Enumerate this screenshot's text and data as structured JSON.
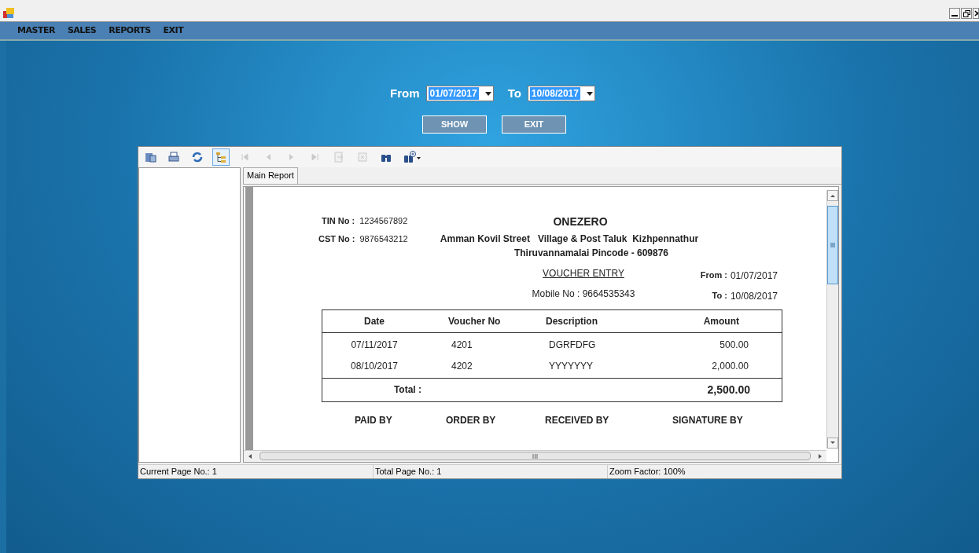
{
  "menu": [
    "MASTER",
    "SALES",
    "REPORTS",
    "EXIT"
  ],
  "filter": {
    "from_label": "From",
    "from_value": "01/07/2017",
    "to_label": "To",
    "to_value": "10/08/2017",
    "buttons": [
      "SHOW",
      "EXIT"
    ]
  },
  "viewer": {
    "toolbar": [
      {
        "kind": "export",
        "disabled": false,
        "selected": false
      },
      {
        "kind": "print",
        "disabled": false,
        "selected": false
      },
      {
        "kind": "refresh",
        "disabled": false,
        "selected": false
      },
      {
        "kind": "tree",
        "disabled": false,
        "selected": true
      },
      {
        "kind": "first",
        "disabled": true,
        "selected": false
      },
      {
        "kind": "prev",
        "disabled": true,
        "selected": false
      },
      {
        "kind": "next",
        "disabled": true,
        "selected": false
      },
      {
        "kind": "last",
        "disabled": true,
        "selected": false
      },
      {
        "kind": "goto",
        "disabled": true,
        "selected": false
      },
      {
        "kind": "stop",
        "disabled": true,
        "selected": false
      },
      {
        "kind": "search",
        "disabled": false,
        "selected": false
      },
      {
        "kind": "zoom",
        "disabled": false,
        "selected": false
      }
    ],
    "tab": "Main Report",
    "report": {
      "tin_label": "TIN No :",
      "tin": "1234567892",
      "cst_label": "CST No :",
      "cst": "9876543212",
      "company": "ONEZERO",
      "address_1": "Amman Kovil Street   Village & Post Taluk  Kizhpennathur",
      "address_2": "Thiruvannamalai Pincode - 609876",
      "title": "VOUCHER ENTRY",
      "mobile": "Mobile No : 9664535343",
      "from_label": "From :",
      "from": "01/07/2017",
      "to_label": "To :",
      "to": "10/08/2017",
      "columns": [
        "Date",
        "Voucher No",
        "Description",
        "Amount"
      ],
      "rows": [
        [
          "07/11/2017",
          "4201",
          "DGRFDFG",
          "500.00"
        ],
        [
          "08/10/2017",
          "4202",
          "YYYYYYY",
          "2,000.00"
        ]
      ],
      "total_label": "Total :",
      "total": "2,500.00",
      "signatures": [
        "PAID BY",
        "ORDER BY",
        "RECEIVED BY",
        "SIGNATURE BY"
      ]
    },
    "status": [
      "Current Page No.: 1",
      "Total Page No.: 1",
      "Zoom Factor: 100%"
    ]
  }
}
